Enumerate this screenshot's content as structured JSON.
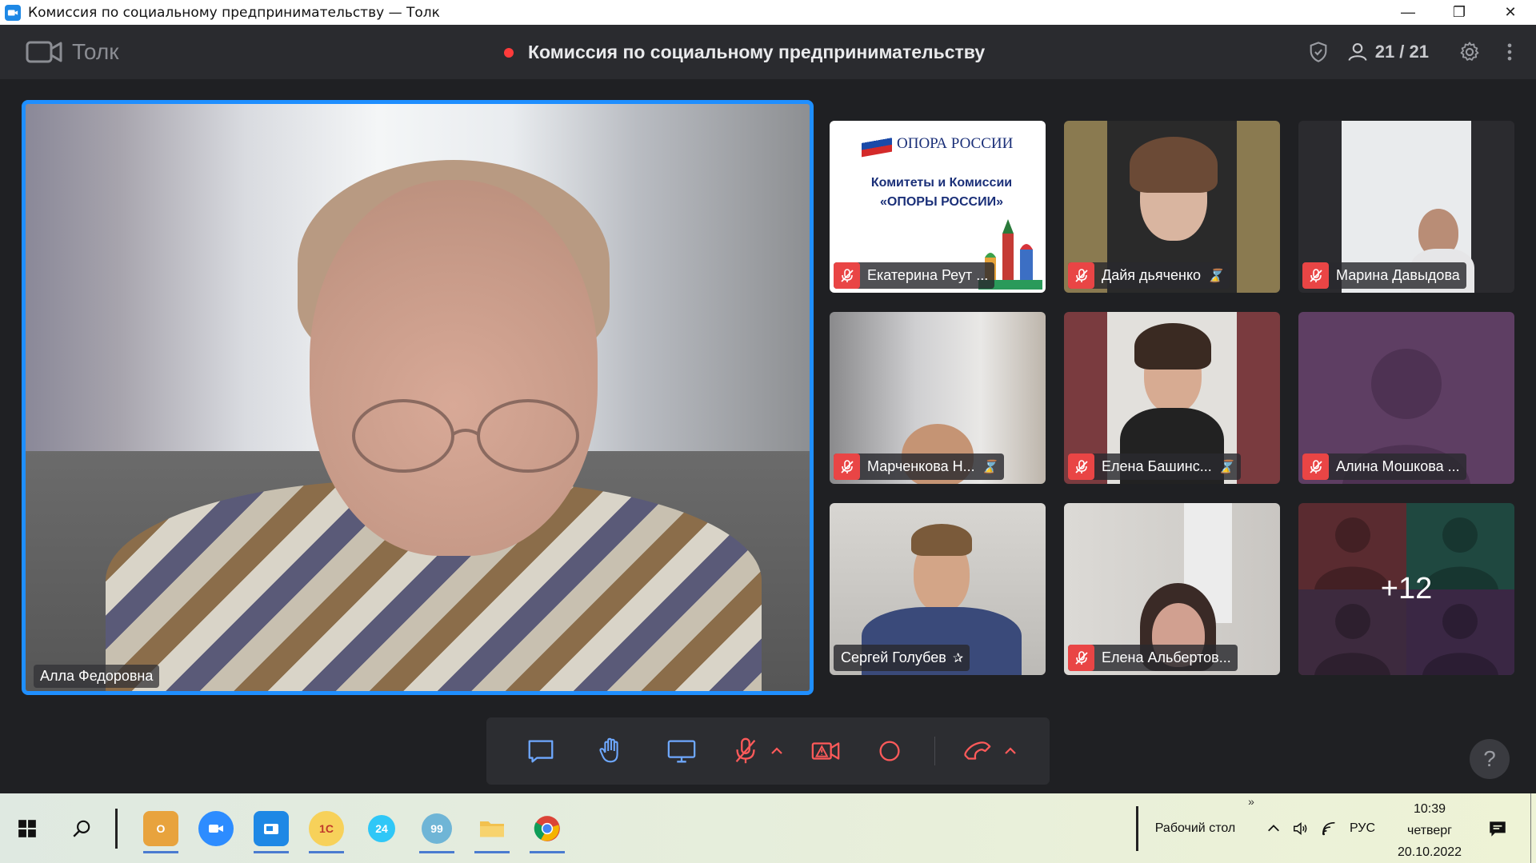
{
  "window": {
    "title": "Комиссия по социальному предпринимательству — Толк",
    "controls": {
      "minimize": "—",
      "maximize": "❐",
      "close": "✕"
    }
  },
  "app": {
    "brand": "Толк",
    "meeting_title": "Комиссия по социальному предпринимательству",
    "participants_count": "21 / 21",
    "recording_color": "#ff3b3b",
    "accent": "#1f8fff"
  },
  "main_video": {
    "name": "Алла Федоровна"
  },
  "tiles": [
    {
      "name": "Екатерина Реут ...",
      "muted": true,
      "extra": ""
    },
    {
      "name": "Дайя дьяченко",
      "muted": true,
      "extra": "⌛"
    },
    {
      "name": "Марина Давыдова",
      "muted": true,
      "extra": ""
    },
    {
      "name": "Марченкова Н...",
      "muted": true,
      "extra": "⌛"
    },
    {
      "name": "Елена Башинс...",
      "muted": true,
      "extra": "⌛"
    },
    {
      "name": "Алина Мошкова ...",
      "muted": true,
      "extra": ""
    },
    {
      "name": "Сергей Голубев",
      "muted": false,
      "extra": "✰"
    },
    {
      "name": "Елена Альбертов...",
      "muted": true,
      "extra": ""
    }
  ],
  "opora_slide": {
    "logo_text": "ОПОРА РОССИИ",
    "line1": "Комитеты и Комиссии",
    "line2": "«ОПОРЫ РОССИИ»"
  },
  "more_tile": {
    "count": "+12"
  },
  "controls": [
    {
      "icon": "chat-icon"
    },
    {
      "icon": "raise-hand-icon"
    },
    {
      "icon": "screen-share-icon"
    },
    {
      "icon": "mic-off-icon"
    },
    {
      "icon": "camera-warning-icon"
    },
    {
      "icon": "record-icon"
    },
    {
      "icon": "hangup-icon"
    }
  ],
  "help": {
    "label": "?"
  },
  "taskbar": {
    "tray_label": "Рабочий стол",
    "language": "РУС",
    "time": "10:39",
    "weekday": "четверг",
    "date": "20.10.2022",
    "apps": [
      {
        "name": "outlook",
        "label": "O",
        "color": "#e8a33d"
      },
      {
        "name": "zoom",
        "label": "",
        "color": "#2d8cff"
      },
      {
        "name": "tolk",
        "label": "",
        "color": "#1e88e5"
      },
      {
        "name": "1c",
        "label": "1С",
        "color": "#f7d15a"
      },
      {
        "name": "bitrix24",
        "label": "24",
        "color": "#2fc7f7"
      },
      {
        "name": "bitrix-notify",
        "label": "99",
        "color": "#6fb5d6"
      },
      {
        "name": "explorer",
        "label": "",
        "color": "#f2c14e"
      },
      {
        "name": "chrome",
        "label": "",
        "color": "#ffffff"
      }
    ]
  }
}
